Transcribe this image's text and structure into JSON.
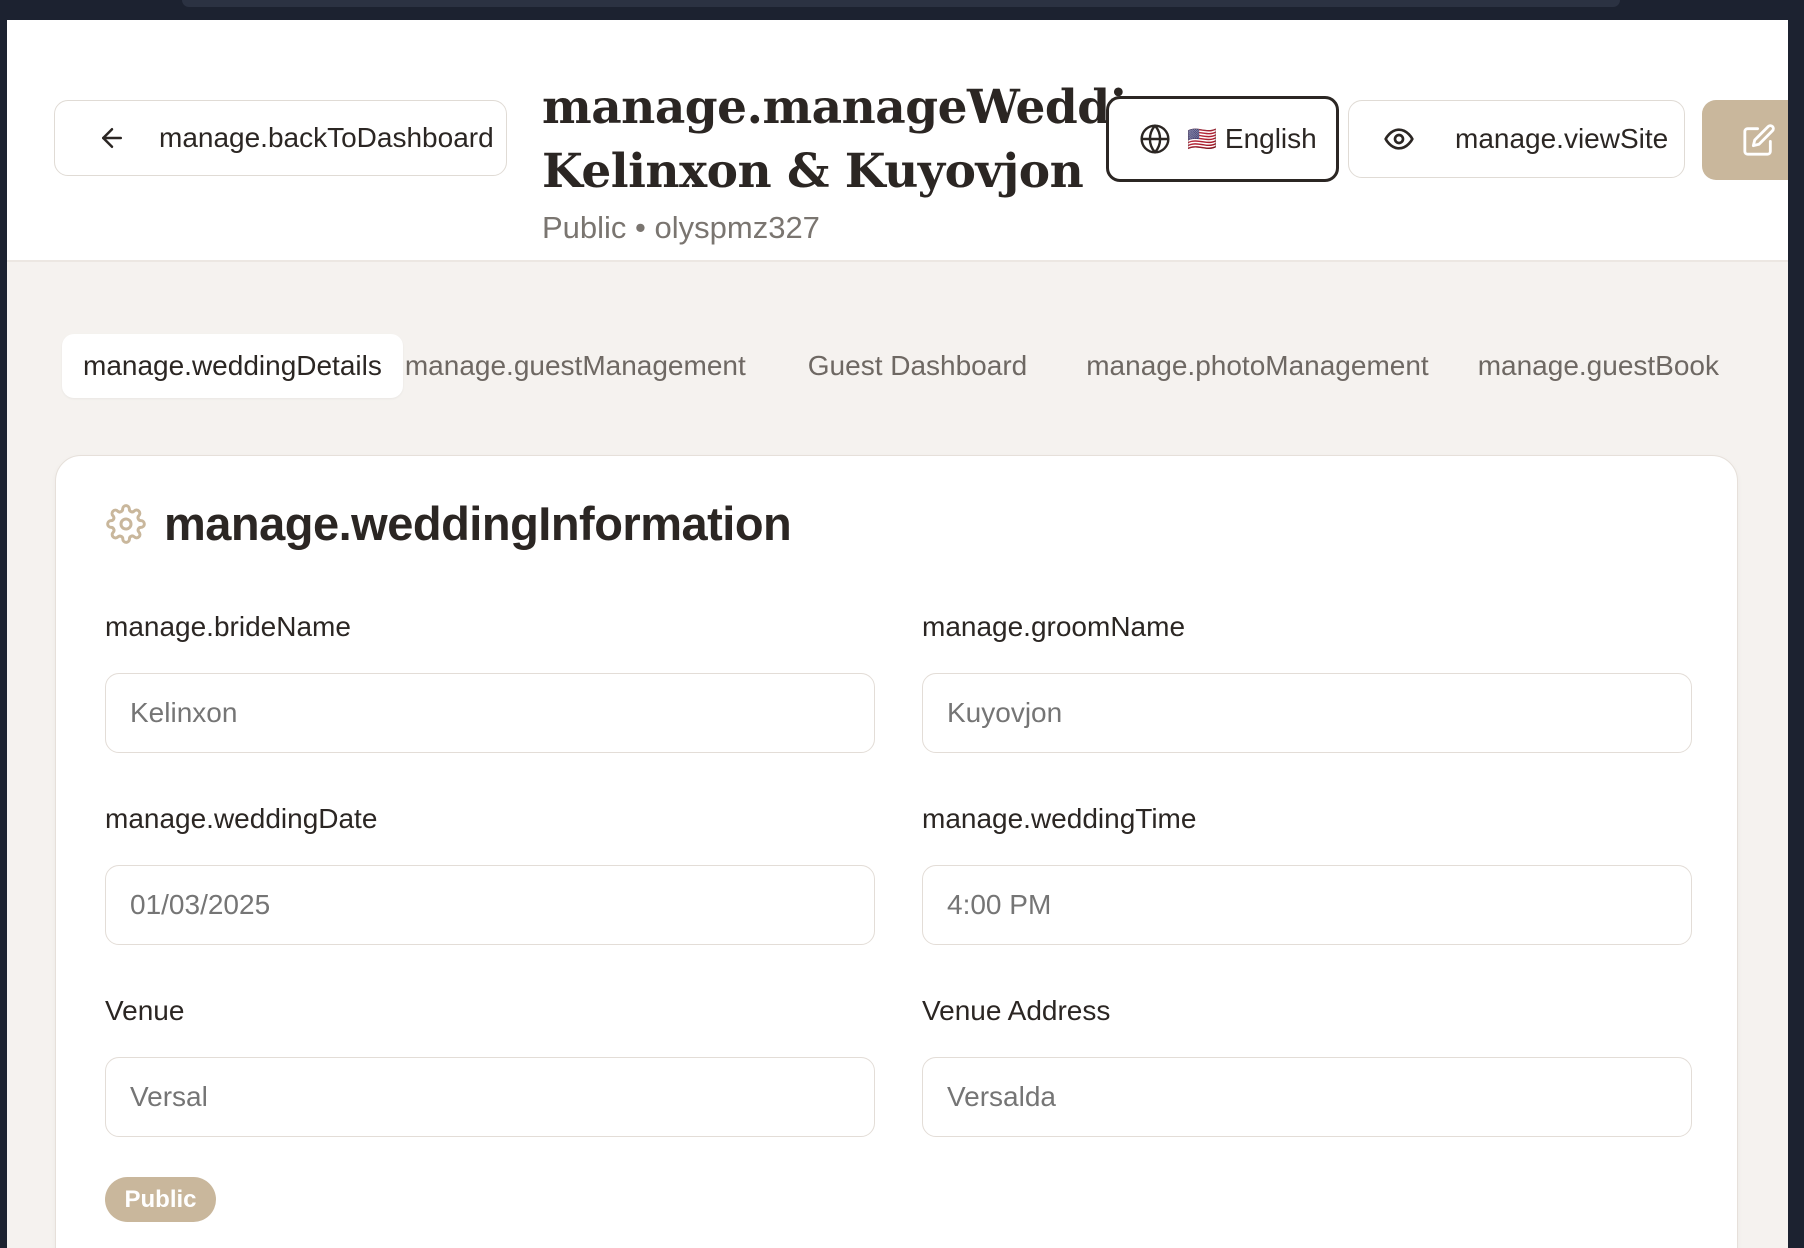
{
  "header": {
    "back_label": "manage.backToDashboard",
    "title_line1": "manage.manageWedding:",
    "title_line2": "Kelinxon & Kuyovjon",
    "subtitle": "Public • olyspmz327",
    "language_flag": "🇺🇸",
    "language_label": "English",
    "view_site_label": "manage.viewSite"
  },
  "tabs": [
    {
      "label": "manage.weddingDetails",
      "active": true
    },
    {
      "label": "manage.guestManagement",
      "active": false
    },
    {
      "label": "Guest Dashboard",
      "active": false
    },
    {
      "label": "manage.photoManagement",
      "active": false
    },
    {
      "label": "manage.guestBook",
      "active": false
    }
  ],
  "card": {
    "title": "manage.weddingInformation",
    "fields": {
      "bride": {
        "label": "manage.brideName",
        "placeholder": "Kelinxon"
      },
      "groom": {
        "label": "manage.groomName",
        "placeholder": "Kuyovjon"
      },
      "date": {
        "label": "manage.weddingDate",
        "placeholder": "01/03/2025"
      },
      "time": {
        "label": "manage.weddingTime",
        "placeholder": "4:00 PM"
      },
      "venue": {
        "label": "Venue",
        "placeholder": "Versal"
      },
      "venue_address": {
        "label": "Venue Address",
        "placeholder": "Versalda"
      }
    },
    "badge": "Public"
  },
  "colors": {
    "accent": "#c9b79c",
    "text": "#2b2623",
    "muted": "#7a7570",
    "page_bg": "#f5f2ef"
  },
  "icons": [
    "arrow-left-icon",
    "globe-icon",
    "eye-icon",
    "edit-icon",
    "gear-icon"
  ]
}
